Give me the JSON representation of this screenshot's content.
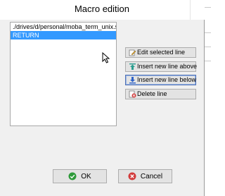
{
  "window": {
    "title": "Macro edition"
  },
  "macro_list": {
    "items": [
      {
        "text": "./drives/d/personal/moba_term_unix.sh",
        "selected": false
      },
      {
        "text": "RETURN",
        "selected": true
      }
    ]
  },
  "actions": {
    "edit_label": "Edit selected line",
    "insert_above_label": "Insert new line above",
    "insert_below_label": "Insert new line below",
    "delete_label": "Delete line"
  },
  "footer": {
    "ok_label": "OK",
    "cancel_label": "Cancel"
  },
  "colors": {
    "selection": "#3399ff",
    "ok_green": "#2e9a3a",
    "cancel_red": "#d23b3b",
    "arrow_teal": "#2a9d8f",
    "arrow_blue": "#2f62c7"
  },
  "icons": {
    "edit": "pencil-icon",
    "insert_above": "arrow-up-icon",
    "insert_below": "arrow-down-icon",
    "delete": "delete-icon",
    "ok": "checkmark-icon",
    "cancel": "x-circle-icon"
  }
}
